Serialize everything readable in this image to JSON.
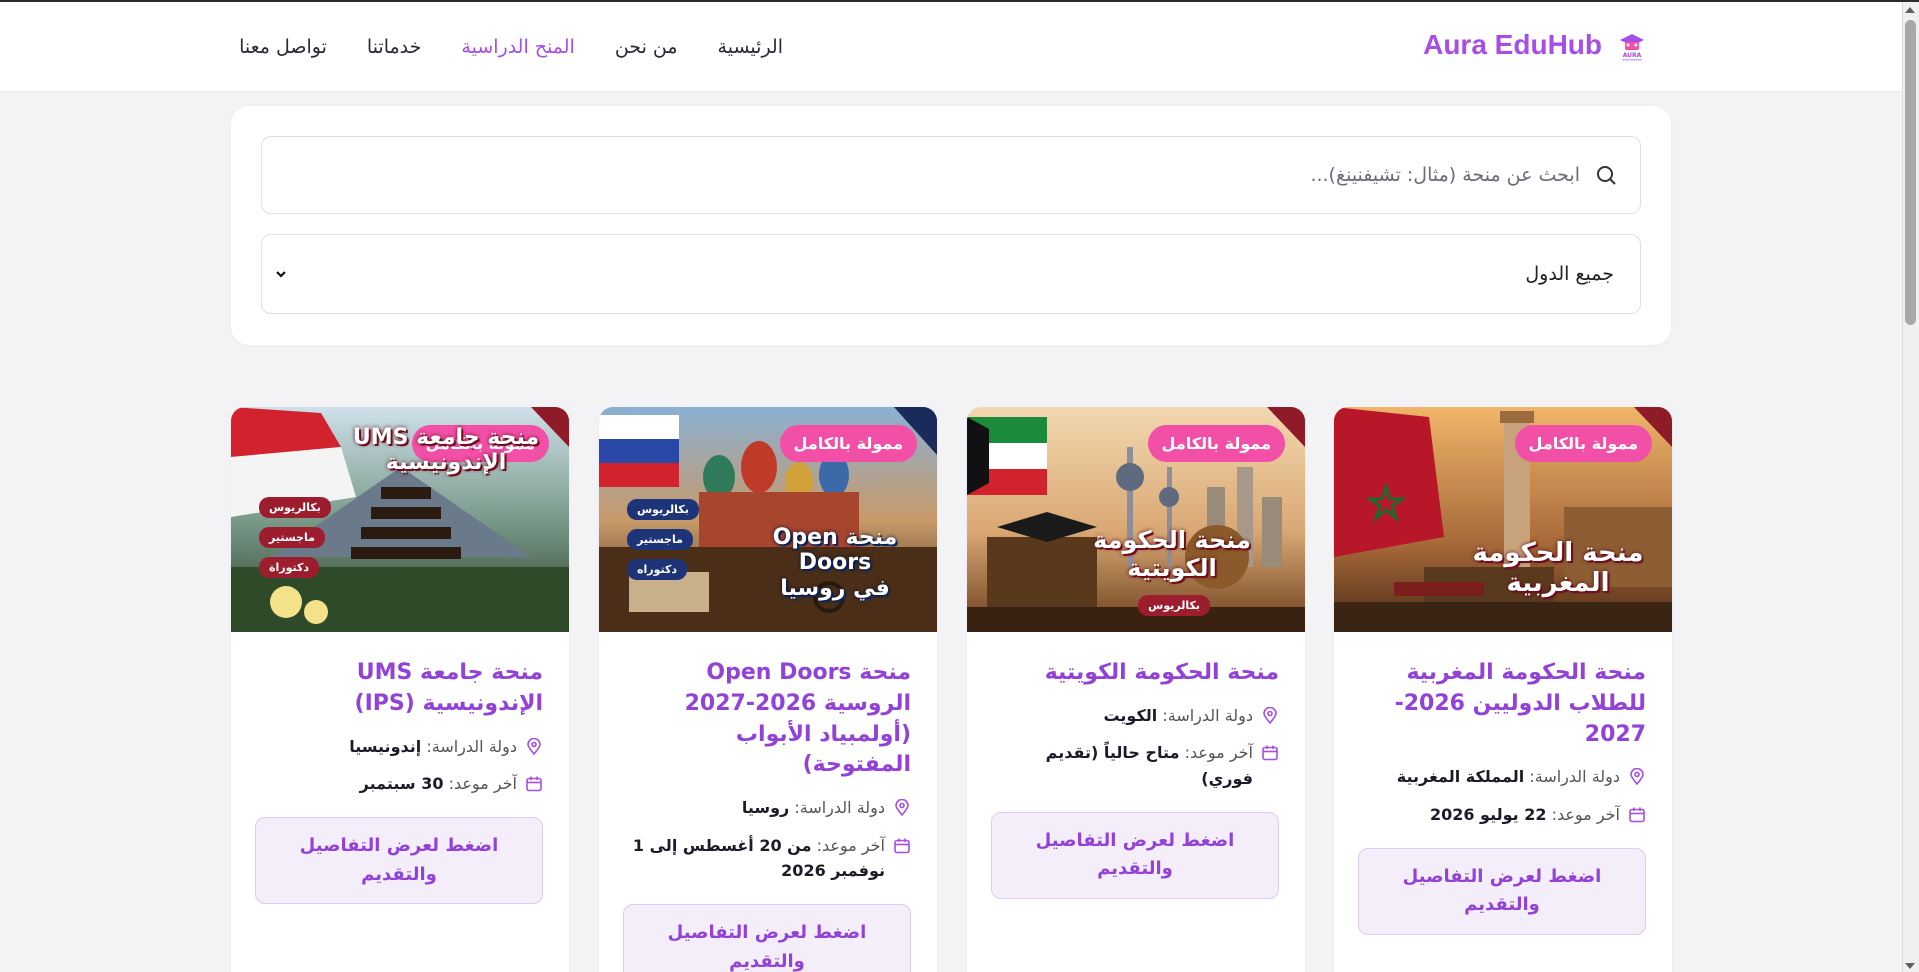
{
  "header": {
    "brand": "Aura EduHub",
    "logo_text": "AURA",
    "nav": [
      {
        "label": "الرئيسية",
        "active": false
      },
      {
        "label": "من نحن",
        "active": false
      },
      {
        "label": "المنح الدراسية",
        "active": true
      },
      {
        "label": "خدماتنا",
        "active": false
      },
      {
        "label": "تواصل معنا",
        "active": false
      }
    ]
  },
  "filters": {
    "search_placeholder": "ابحث عن منحة (مثال: تشيفنينغ)...",
    "country_selected": "جميع الدول"
  },
  "labels": {
    "country_label": "دولة الدراسة:",
    "deadline_label": "آخر موعد:",
    "details_button": "اضغط لعرض التفاصيل والتقديم"
  },
  "colors": {
    "accent": "#9242d6",
    "brand": "#a64ee6",
    "badge": "#f24fa6"
  },
  "cards": [
    {
      "badge": "ممولة بالكامل",
      "image_title_1": "منحة الحكومة",
      "image_title_2": "المغربية",
      "title": "منحة الحكومة المغربية للطلاب الدوليين 2026-2027",
      "country": "المملكة المغربية",
      "deadline": "22 يوليو 2026"
    },
    {
      "badge": "ممولة بالكامل",
      "image_title_1": "منحة الحكومة",
      "image_title_2": "الكويتية",
      "image_level": "بكالريوس",
      "title": "منحة الحكومة الكويتية",
      "country": "الكويت",
      "deadline": "متاح حالياً (تقديم فوري)"
    },
    {
      "badge": "ممولة بالكامل",
      "image_title_1": "منحة Open Doors",
      "image_title_2": "في روسيا",
      "image_levels": [
        "بكالريوس",
        "ماجستير",
        "دكتوراه"
      ],
      "title": "منحة Open Doors الروسية 2026-2027 (أولمبياد الأبواب المفتوحة)",
      "country": "روسيا",
      "deadline": "من 20 أغسطس إلى 1 نوفمبر 2026"
    },
    {
      "badge": "ممولة بالكامل",
      "image_title_1": "منحة جامعة UMS",
      "image_title_2": "الإندونيسية",
      "image_levels": [
        "بكالريوس",
        "ماجستير",
        "دكتوراة"
      ],
      "title": "منحة جامعة UMS الإندونيسية (IPS)",
      "country": "إندونيسيا",
      "deadline": "30 سبتمبر"
    }
  ]
}
